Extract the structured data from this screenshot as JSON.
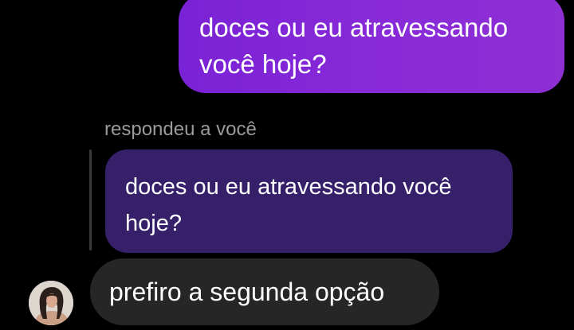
{
  "thread": {
    "outgoing_message": "doces ou eu atravessando você hoje?",
    "reply_label": "respondeu a você",
    "quoted_message": "doces ou eu atravessando você hoje?",
    "incoming_message": "prefiro a segunda opção"
  },
  "contact": {
    "avatar_icon": "profile-photo-icon"
  },
  "colors": {
    "background": "#000000",
    "outgoing_bubble": "#8a2bd8",
    "quoted_bubble": "#36206a",
    "incoming_bubble": "#262626",
    "reply_label": "#9b9b9b",
    "text": "#ffffff"
  }
}
